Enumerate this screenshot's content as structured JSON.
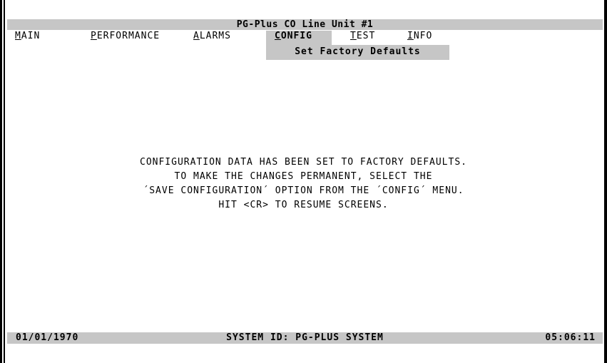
{
  "window_title": "PG-Plus CO Line Unit #1",
  "menu": [
    {
      "hot": "M",
      "rest": "AIN"
    },
    {
      "hot": "P",
      "rest": "ERFORMANCE"
    },
    {
      "hot": "A",
      "rest": "LARMS"
    },
    {
      "hot": "C",
      "rest": "ONFIG"
    },
    {
      "hot": "T",
      "rest": "EST"
    },
    {
      "hot": "I",
      "rest": "NFO"
    }
  ],
  "active_menu": "CONFIG",
  "submenu": {
    "selected": "Set Factory Defaults"
  },
  "message": {
    "line1": "CONFIGURATION DATA HAS BEEN SET TO FACTORY DEFAULTS.",
    "line2": "TO MAKE THE CHANGES PERMANENT, SELECT THE",
    "line3": "´SAVE CONFIGURATION´ OPTION FROM THE ´CONFIG´ MENU.",
    "line4": "HIT <CR> TO RESUME SCREENS."
  },
  "status_bar": {
    "date": "01/01/1970",
    "system": "SYSTEM ID: PG-PLUS SYSTEM",
    "time": "05:06:11"
  }
}
